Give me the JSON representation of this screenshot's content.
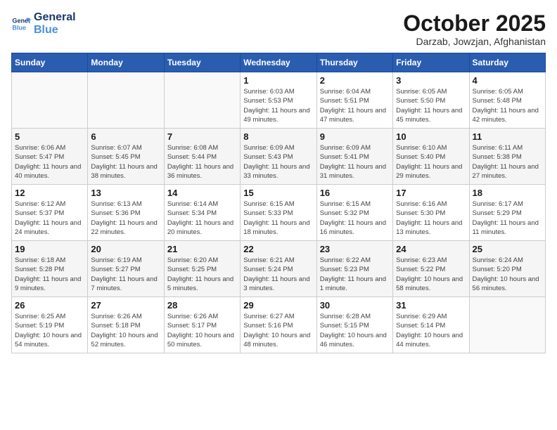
{
  "logo": {
    "line1": "General",
    "line2": "Blue"
  },
  "title": "October 2025",
  "location": "Darzab, Jowzjan, Afghanistan",
  "weekdays": [
    "Sunday",
    "Monday",
    "Tuesday",
    "Wednesday",
    "Thursday",
    "Friday",
    "Saturday"
  ],
  "weeks": [
    [
      {
        "day": "",
        "sunrise": "",
        "sunset": "",
        "daylight": ""
      },
      {
        "day": "",
        "sunrise": "",
        "sunset": "",
        "daylight": ""
      },
      {
        "day": "",
        "sunrise": "",
        "sunset": "",
        "daylight": ""
      },
      {
        "day": "1",
        "sunrise": "Sunrise: 6:03 AM",
        "sunset": "Sunset: 5:53 PM",
        "daylight": "Daylight: 11 hours and 49 minutes."
      },
      {
        "day": "2",
        "sunrise": "Sunrise: 6:04 AM",
        "sunset": "Sunset: 5:51 PM",
        "daylight": "Daylight: 11 hours and 47 minutes."
      },
      {
        "day": "3",
        "sunrise": "Sunrise: 6:05 AM",
        "sunset": "Sunset: 5:50 PM",
        "daylight": "Daylight: 11 hours and 45 minutes."
      },
      {
        "day": "4",
        "sunrise": "Sunrise: 6:05 AM",
        "sunset": "Sunset: 5:48 PM",
        "daylight": "Daylight: 11 hours and 42 minutes."
      }
    ],
    [
      {
        "day": "5",
        "sunrise": "Sunrise: 6:06 AM",
        "sunset": "Sunset: 5:47 PM",
        "daylight": "Daylight: 11 hours and 40 minutes."
      },
      {
        "day": "6",
        "sunrise": "Sunrise: 6:07 AM",
        "sunset": "Sunset: 5:45 PM",
        "daylight": "Daylight: 11 hours and 38 minutes."
      },
      {
        "day": "7",
        "sunrise": "Sunrise: 6:08 AM",
        "sunset": "Sunset: 5:44 PM",
        "daylight": "Daylight: 11 hours and 36 minutes."
      },
      {
        "day": "8",
        "sunrise": "Sunrise: 6:09 AM",
        "sunset": "Sunset: 5:43 PM",
        "daylight": "Daylight: 11 hours and 33 minutes."
      },
      {
        "day": "9",
        "sunrise": "Sunrise: 6:09 AM",
        "sunset": "Sunset: 5:41 PM",
        "daylight": "Daylight: 11 hours and 31 minutes."
      },
      {
        "day": "10",
        "sunrise": "Sunrise: 6:10 AM",
        "sunset": "Sunset: 5:40 PM",
        "daylight": "Daylight: 11 hours and 29 minutes."
      },
      {
        "day": "11",
        "sunrise": "Sunrise: 6:11 AM",
        "sunset": "Sunset: 5:38 PM",
        "daylight": "Daylight: 11 hours and 27 minutes."
      }
    ],
    [
      {
        "day": "12",
        "sunrise": "Sunrise: 6:12 AM",
        "sunset": "Sunset: 5:37 PM",
        "daylight": "Daylight: 11 hours and 24 minutes."
      },
      {
        "day": "13",
        "sunrise": "Sunrise: 6:13 AM",
        "sunset": "Sunset: 5:36 PM",
        "daylight": "Daylight: 11 hours and 22 minutes."
      },
      {
        "day": "14",
        "sunrise": "Sunrise: 6:14 AM",
        "sunset": "Sunset: 5:34 PM",
        "daylight": "Daylight: 11 hours and 20 minutes."
      },
      {
        "day": "15",
        "sunrise": "Sunrise: 6:15 AM",
        "sunset": "Sunset: 5:33 PM",
        "daylight": "Daylight: 11 hours and 18 minutes."
      },
      {
        "day": "16",
        "sunrise": "Sunrise: 6:15 AM",
        "sunset": "Sunset: 5:32 PM",
        "daylight": "Daylight: 11 hours and 16 minutes."
      },
      {
        "day": "17",
        "sunrise": "Sunrise: 6:16 AM",
        "sunset": "Sunset: 5:30 PM",
        "daylight": "Daylight: 11 hours and 13 minutes."
      },
      {
        "day": "18",
        "sunrise": "Sunrise: 6:17 AM",
        "sunset": "Sunset: 5:29 PM",
        "daylight": "Daylight: 11 hours and 11 minutes."
      }
    ],
    [
      {
        "day": "19",
        "sunrise": "Sunrise: 6:18 AM",
        "sunset": "Sunset: 5:28 PM",
        "daylight": "Daylight: 11 hours and 9 minutes."
      },
      {
        "day": "20",
        "sunrise": "Sunrise: 6:19 AM",
        "sunset": "Sunset: 5:27 PM",
        "daylight": "Daylight: 11 hours and 7 minutes."
      },
      {
        "day": "21",
        "sunrise": "Sunrise: 6:20 AM",
        "sunset": "Sunset: 5:25 PM",
        "daylight": "Daylight: 11 hours and 5 minutes."
      },
      {
        "day": "22",
        "sunrise": "Sunrise: 6:21 AM",
        "sunset": "Sunset: 5:24 PM",
        "daylight": "Daylight: 11 hours and 3 minutes."
      },
      {
        "day": "23",
        "sunrise": "Sunrise: 6:22 AM",
        "sunset": "Sunset: 5:23 PM",
        "daylight": "Daylight: 11 hours and 1 minute."
      },
      {
        "day": "24",
        "sunrise": "Sunrise: 6:23 AM",
        "sunset": "Sunset: 5:22 PM",
        "daylight": "Daylight: 10 hours and 58 minutes."
      },
      {
        "day": "25",
        "sunrise": "Sunrise: 6:24 AM",
        "sunset": "Sunset: 5:20 PM",
        "daylight": "Daylight: 10 hours and 56 minutes."
      }
    ],
    [
      {
        "day": "26",
        "sunrise": "Sunrise: 6:25 AM",
        "sunset": "Sunset: 5:19 PM",
        "daylight": "Daylight: 10 hours and 54 minutes."
      },
      {
        "day": "27",
        "sunrise": "Sunrise: 6:26 AM",
        "sunset": "Sunset: 5:18 PM",
        "daylight": "Daylight: 10 hours and 52 minutes."
      },
      {
        "day": "28",
        "sunrise": "Sunrise: 6:26 AM",
        "sunset": "Sunset: 5:17 PM",
        "daylight": "Daylight: 10 hours and 50 minutes."
      },
      {
        "day": "29",
        "sunrise": "Sunrise: 6:27 AM",
        "sunset": "Sunset: 5:16 PM",
        "daylight": "Daylight: 10 hours and 48 minutes."
      },
      {
        "day": "30",
        "sunrise": "Sunrise: 6:28 AM",
        "sunset": "Sunset: 5:15 PM",
        "daylight": "Daylight: 10 hours and 46 minutes."
      },
      {
        "day": "31",
        "sunrise": "Sunrise: 6:29 AM",
        "sunset": "Sunset: 5:14 PM",
        "daylight": "Daylight: 10 hours and 44 minutes."
      },
      {
        "day": "",
        "sunrise": "",
        "sunset": "",
        "daylight": ""
      }
    ]
  ]
}
